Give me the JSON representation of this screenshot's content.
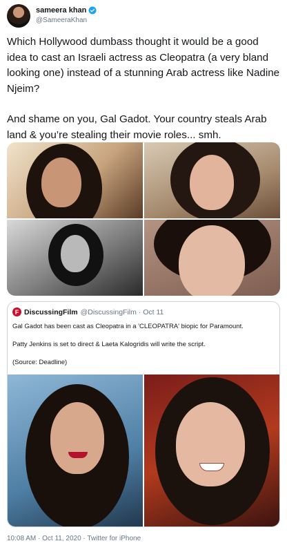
{
  "header": {
    "display_name": "sameera khan",
    "handle": "@SameeraKhan",
    "verified_color": "#1da1f2"
  },
  "tweet": {
    "paragraphs": [
      "Which Hollywood dumbass thought it would be a good idea to cast an Israeli actress as Cleopatra (a very bland looking one) instead of a stunning Arab actress like Nadine Njeim?",
      "And shame on you, Gal Gadot. Your country steals Arab land & you’re stealing their movie roles... smh."
    ]
  },
  "quote": {
    "avatar_letter": "F",
    "name": "DiscussingFilm",
    "handle_date": "@DiscussingFilm · Oct 11",
    "paragraphs": [
      "Gal Gadot has been cast as Cleopatra in a 'CLEOPATRA' biopic for Paramount.",
      "Patty Jenkins is set to direct & Laeta Kalogridis will write the script.",
      "(Source: Deadline)"
    ]
  },
  "footer": {
    "meta": "10:08 AM · Oct 11, 2020 · Twitter for iPhone"
  }
}
